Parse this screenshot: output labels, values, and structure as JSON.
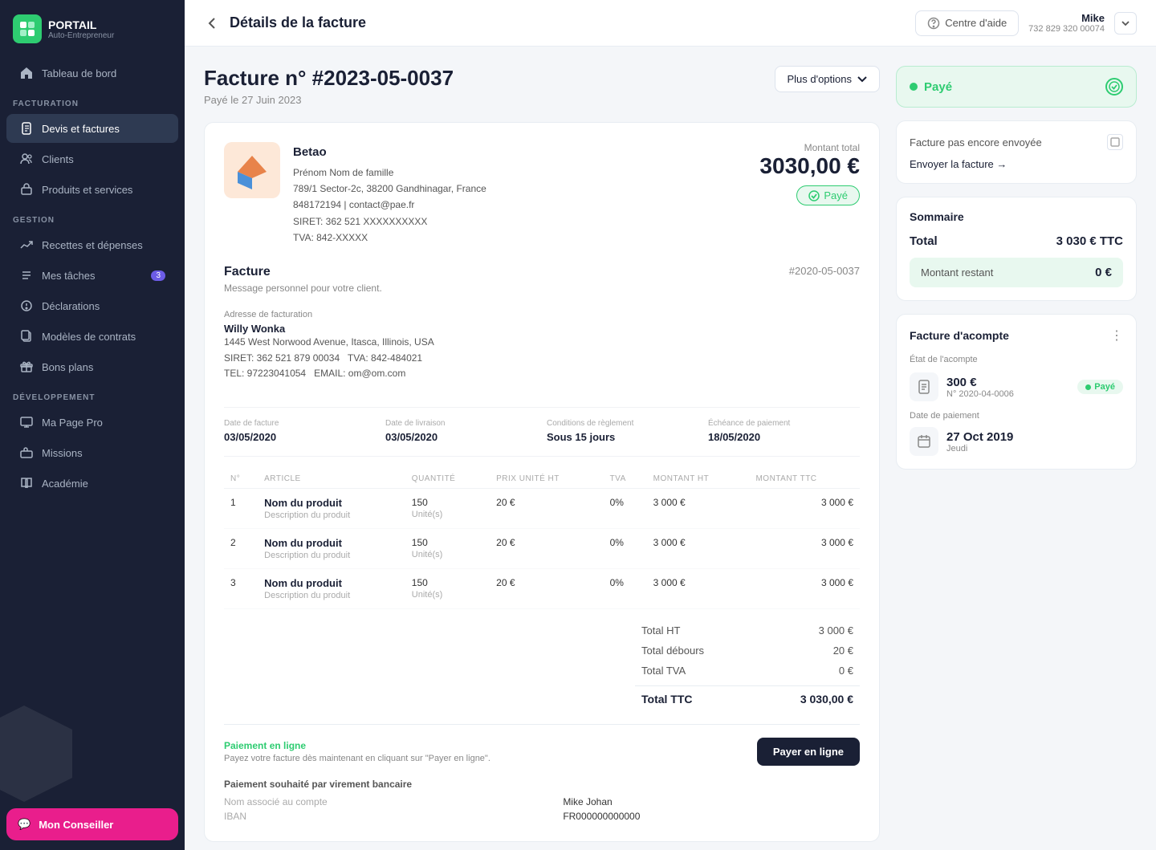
{
  "app": {
    "logo_text": "PORTAIL",
    "logo_sub": "Auto-Entrepreneur"
  },
  "sidebar": {
    "items": [
      {
        "id": "tableau-de-bord",
        "label": "Tableau de bord",
        "icon": "home",
        "active": false
      },
      {
        "id": "devis-factures",
        "label": "Devis et factures",
        "icon": "file-text",
        "active": true
      },
      {
        "id": "clients",
        "label": "Clients",
        "icon": "users",
        "active": false
      },
      {
        "id": "produits",
        "label": "Produits et services",
        "icon": "box",
        "active": false
      },
      {
        "id": "recettes",
        "label": "Recettes et dépenses",
        "icon": "trending-up",
        "active": false
      },
      {
        "id": "taches",
        "label": "Mes tâches",
        "icon": "list",
        "badge": "3",
        "active": false
      },
      {
        "id": "declarations",
        "label": "Déclarations",
        "icon": "document",
        "active": false
      },
      {
        "id": "modeles",
        "label": "Modèles de contrats",
        "icon": "file-copy",
        "active": false
      },
      {
        "id": "bons-plans",
        "label": "Bons plans",
        "icon": "gift",
        "active": false
      }
    ],
    "sections": [
      {
        "label": "Facturation",
        "start": 1
      },
      {
        "label": "Gestion",
        "start": 4
      },
      {
        "label": "Développement",
        "start": 8
      }
    ],
    "dev_items": [
      {
        "id": "ma-page-pro",
        "label": "Ma Page Pro",
        "icon": "monitor"
      },
      {
        "id": "missions",
        "label": "Missions",
        "icon": "briefcase"
      },
      {
        "id": "academie",
        "label": "Académie",
        "icon": "book"
      }
    ],
    "conseiller_label": "Mon Conseiller"
  },
  "header": {
    "back_label": "←",
    "title": "Détails de la facture",
    "help_label": "Centre d'aide",
    "user": {
      "name": "Mike",
      "phone": "732 829 320 00074"
    }
  },
  "invoice": {
    "title": "Facture n° #2023-05-0037",
    "date": "Payé le 27 Juin 2023",
    "more_options": "Plus d'options",
    "company": {
      "name": "Betao",
      "contact": "Prénom Nom de famille",
      "address": "789/1 Sector-2c, 38200 Gandhinagar, France",
      "phone": "848172194",
      "email": "contact@pae.fr",
      "siret": "SIRET: 362 521 XXXXXXXXXX",
      "tva": "TVA: 842-XXXXX"
    },
    "amount_label": "Montant total",
    "amount": "3030,00 €",
    "paid_label": "Payé",
    "invoice_label": "Facture",
    "invoice_number": "#2020-05-0037",
    "message": "Message personnel pour votre client.",
    "billing": {
      "label": "Adresse de facturation",
      "name": "Willy Wonka",
      "address": "1445 West Norwood Avenue, Itasca, Illinois, USA",
      "siret": "SIRET: 362 521 879 00034",
      "tva": "TVA: 842-484021",
      "tel": "TEL: 97223041054",
      "email": "EMAIL: om@om.com"
    },
    "dates": [
      {
        "label": "Date de facture",
        "value": "03/05/2020"
      },
      {
        "label": "Date de livraison",
        "value": "03/05/2020"
      },
      {
        "label": "Conditions de règlement",
        "value": "Sous 15 jours"
      },
      {
        "label": "Échéance de paiement",
        "value": "18/05/2020"
      }
    ],
    "table": {
      "headers": [
        "N°",
        "ARTICLE",
        "QUANTITÉ",
        "PRIX UNITÉ HT",
        "TVA",
        "MONTANT HT",
        "MONTANT TTC"
      ],
      "rows": [
        {
          "num": "1",
          "name": "Nom du produit",
          "desc": "Description du produit",
          "qty": "150",
          "unit": "Unité(s)",
          "price": "20 €",
          "tva": "0%",
          "ht": "3 000 €",
          "ttc": "3 000 €"
        },
        {
          "num": "2",
          "name": "Nom du produit",
          "desc": "Description du produit",
          "qty": "150",
          "unit": "Unité(s)",
          "price": "20 €",
          "tva": "0%",
          "ht": "3 000 €",
          "ttc": "3 000 €"
        },
        {
          "num": "3",
          "name": "Nom du produit",
          "desc": "Description du produit",
          "qty": "150",
          "unit": "Unité(s)",
          "price": "20 €",
          "tva": "0%",
          "ht": "3 000 €",
          "ttc": "3 000 €"
        }
      ]
    },
    "totals": {
      "total_ht_label": "Total HT",
      "total_ht": "3 000 €",
      "total_debours_label": "Total débours",
      "total_debours": "20 €",
      "total_tva_label": "Total TVA",
      "total_tva": "0 €",
      "total_ttc_label": "Total TTC",
      "total_ttc": "3 030,00 €"
    },
    "payment": {
      "online_label": "Paiement en ligne",
      "online_desc": "Payez votre facture dès maintenant en cliquant sur \"Payer en ligne\".",
      "pay_btn": "Payer en ligne",
      "bank_label": "Paiement souhaité par virement bancaire",
      "account_label": "Nom associé au compte",
      "account_value": "Mike Johan",
      "iban_label": "IBAN",
      "iban_value": "FR000000000000"
    }
  },
  "right_panel": {
    "status": "Payé",
    "not_sent_label": "Facture pas encore envoyée",
    "send_label": "Envoyer la facture →",
    "summary": {
      "title": "Sommaire",
      "total_label": "Total",
      "total_value": "3 030 € TTC",
      "remaining_label": "Montant restant",
      "remaining_value": "0 €"
    },
    "acompte": {
      "title": "Facture d'acompte",
      "etat_label": "État de l'acompte",
      "amount": "300 €",
      "number": "N° 2020-04-0006",
      "paid_badge": "● Payé",
      "date_label": "Date de paiement",
      "date_value": "27 Oct 2019",
      "date_day": "Jeudi"
    }
  }
}
